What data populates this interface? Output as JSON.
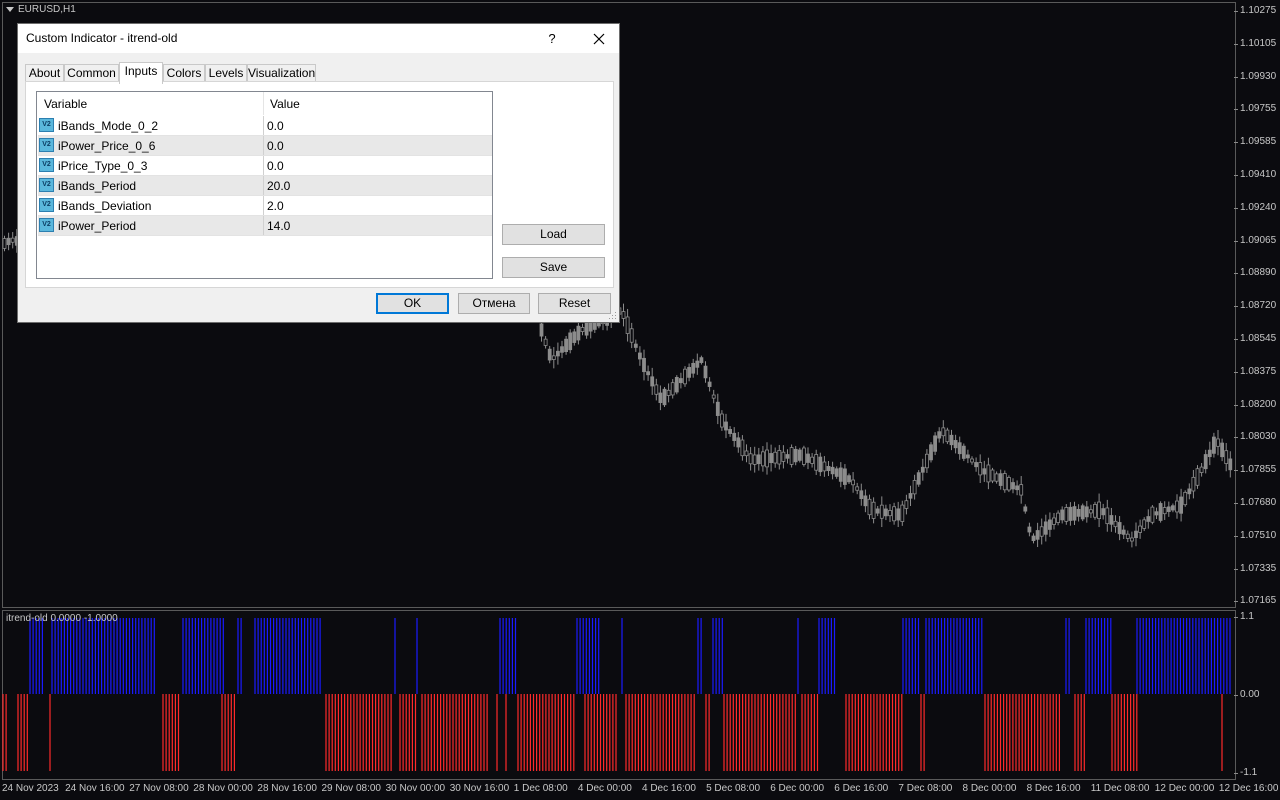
{
  "chart": {
    "symbol": "EURUSD,H1",
    "price_axis": [
      "1.10275",
      "1.10105",
      "1.09930",
      "1.09755",
      "1.09585",
      "1.09410",
      "1.09240",
      "1.09065",
      "1.08890",
      "1.08720",
      "1.08545",
      "1.08375",
      "1.08200",
      "1.08030",
      "1.07855",
      "1.07680",
      "1.07510",
      "1.07335",
      "1.07165"
    ],
    "time_axis": [
      "24 Nov 2023",
      "24 Nov 16:00",
      "27 Nov 08:00",
      "28 Nov 00:00",
      "28 Nov 16:00",
      "29 Nov 08:00",
      "30 Nov 00:00",
      "30 Nov 16:00",
      "1 Dec 08:00",
      "4 Dec 00:00",
      "4 Dec 16:00",
      "5 Dec 08:00",
      "6 Dec 00:00",
      "6 Dec 16:00",
      "7 Dec 08:00",
      "8 Dec 00:00",
      "8 Dec 16:00",
      "11 Dec 08:00",
      "12 Dec 00:00",
      "12 Dec 16:00"
    ],
    "indicator_label": "itrend-old 0.0000 -1.0000",
    "indicator_axis": [
      "1.1",
      "0.00",
      "-1.1"
    ],
    "colors": {
      "background": "#0b0b0f",
      "candle": "#8c8c8c",
      "bull_bar": "#1a1aff",
      "bear_bar": "#ff2a2a",
      "axis_text": "#c8c8c8"
    }
  },
  "dialog": {
    "title": "Custom Indicator - itrend-old",
    "help": "?",
    "tabs": [
      {
        "label": "About"
      },
      {
        "label": "Common"
      },
      {
        "label": "Inputs"
      },
      {
        "label": "Colors"
      },
      {
        "label": "Levels"
      },
      {
        "label": "Visualization"
      }
    ],
    "active_tab": "Inputs",
    "grid": {
      "col_variable": "Variable",
      "col_value": "Value",
      "icon_text": "V2",
      "rows": [
        {
          "variable": "iBands_Mode_0_2",
          "value": "0.0"
        },
        {
          "variable": "iPower_Price_0_6",
          "value": "0.0"
        },
        {
          "variable": "iPrice_Type_0_3",
          "value": "0.0"
        },
        {
          "variable": "iBands_Period",
          "value": "20.0"
        },
        {
          "variable": "iBands_Deviation",
          "value": "2.0"
        },
        {
          "variable": "iPower_Period",
          "value": "14.0"
        }
      ]
    },
    "load_label": "Load",
    "save_label": "Save",
    "ok_label": "OK",
    "cancel_label": "Отмена",
    "reset_label": "Reset"
  }
}
